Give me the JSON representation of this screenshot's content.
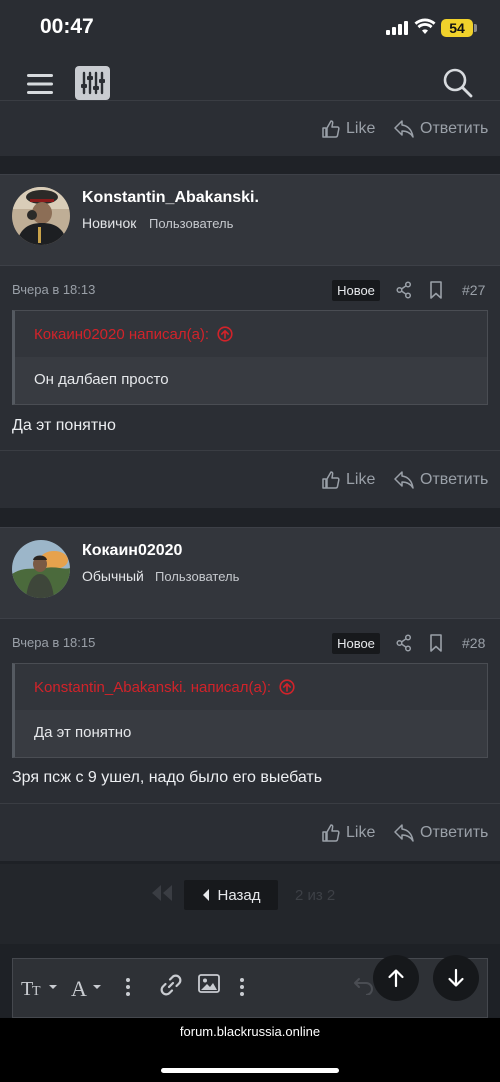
{
  "status_bar": {
    "time": "00:47",
    "battery": "54"
  },
  "app_header": {
    "menu_icon": "hamburger-icon",
    "filter_icon": "sliders-icon",
    "search_icon": "search-icon"
  },
  "actions": {
    "like": "Like",
    "reply": "Ответить"
  },
  "posts": [
    {
      "author": "Konstantin_Abakanski.",
      "rank": "Новичок",
      "role": "Пользователь",
      "date": "Вчера в 18:13",
      "badge": "Новое",
      "number": "#27",
      "quote_author": "Кокаин02020 написал(а):",
      "quote_text": "Он далбаеп просто",
      "message": "Да эт понятно"
    },
    {
      "author": "Кокаин02020",
      "rank": "Обычный",
      "role": "Пользователь",
      "date": "Вчера в 18:15",
      "badge": "Новое",
      "number": "#28",
      "quote_author": "Konstantin_Abakanski. написал(а):",
      "quote_text": "Да эт понятно",
      "message": "Зря псж с 9 ушел, надо было его выебать"
    }
  ],
  "pagination": {
    "back": "Назад",
    "label": "2 из 2"
  },
  "editor": {
    "text_size_icon": "text-size-icon",
    "font_color_icon": "font-color-icon",
    "link_icon": "link-icon",
    "image_icon": "image-icon"
  },
  "browser": {
    "url": "forum.blackrussia.online"
  }
}
